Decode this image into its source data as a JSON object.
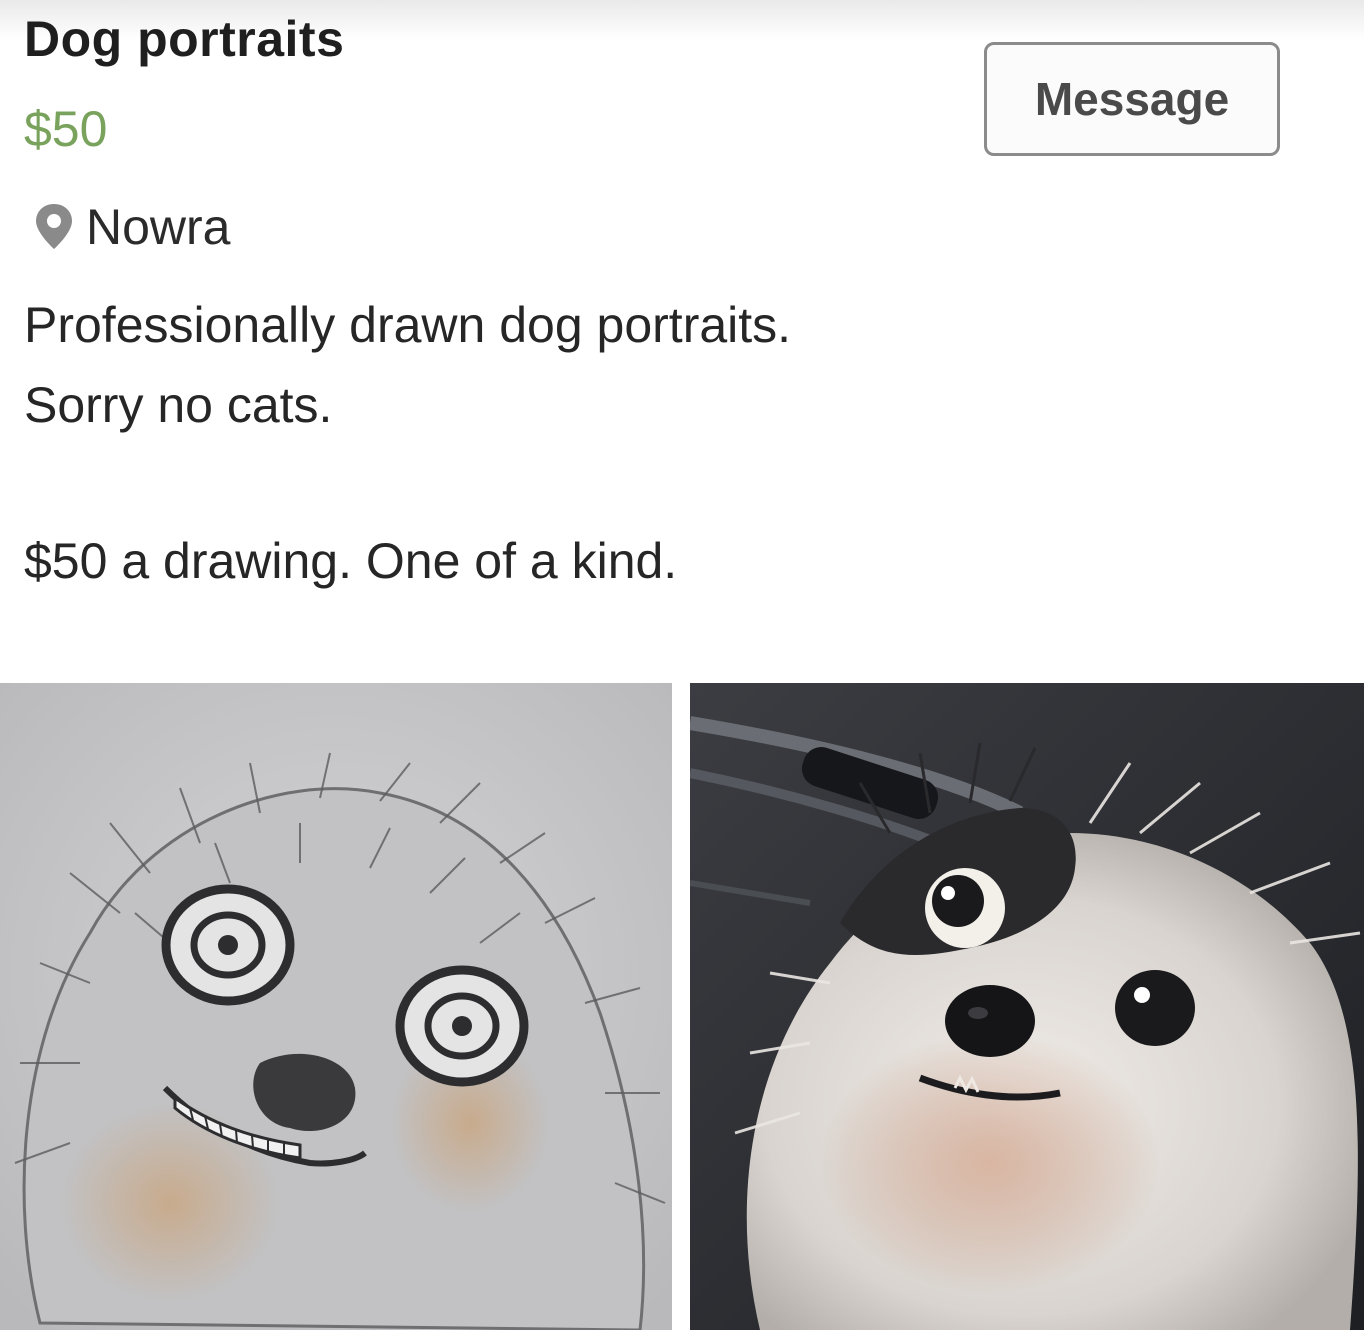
{
  "listing": {
    "title": "Dog portraits",
    "price": "$50",
    "location": "Nowra",
    "description_lines": [
      "Professionally drawn dog portraits.",
      "Sorry no cats.",
      "$50 a drawing. One of a kind."
    ]
  },
  "actions": {
    "message_label": "Message"
  },
  "icons": {
    "location": "map-pin-icon"
  },
  "colors": {
    "price": "#79a35d",
    "text": "#262626",
    "button_border": "#8b8b8b"
  },
  "photos": [
    {
      "subject": "pencil drawing of a dog"
    },
    {
      "subject": "photo of a shih tzu dog"
    }
  ]
}
